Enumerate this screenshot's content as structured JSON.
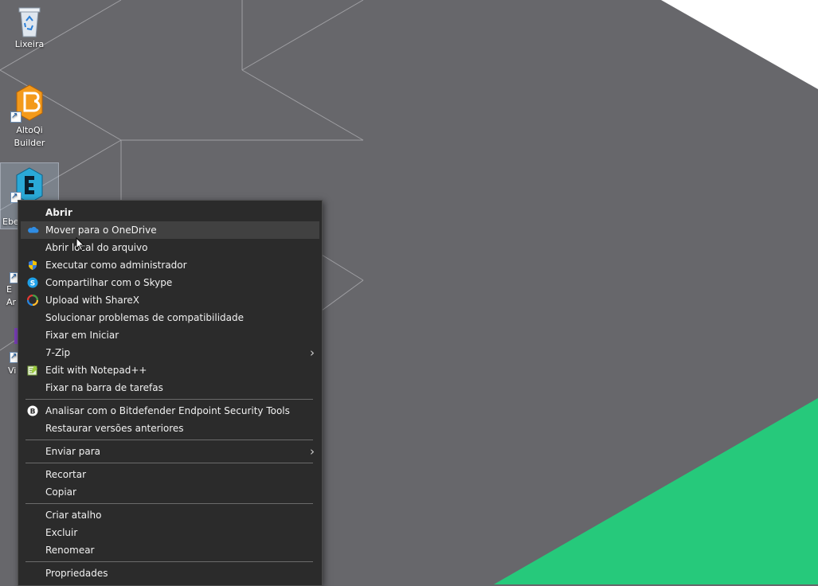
{
  "desktop": {
    "icons": [
      {
        "label": "Lixeira",
        "icon": "recycle-bin-icon"
      },
      {
        "label": "AltoQi\nBuilder",
        "icon": "altoqi-builder-icon"
      },
      {
        "label": "Ebe",
        "icon": "eberick-icon"
      },
      {
        "label": "E\nAr",
        "icon": "shortcut-app-icon"
      },
      {
        "label": "Vi",
        "icon": "shortcut-app-icon"
      }
    ],
    "colors": {
      "wallpaper": "#67676b",
      "accent_green": "#26c97b",
      "accent_white": "#ffffff"
    }
  },
  "context_menu": {
    "items": [
      {
        "label": "Abrir",
        "bold": true
      },
      {
        "label": "Mover para o OneDrive",
        "icon": "onedrive-icon",
        "hover": true
      },
      {
        "label": "Abrir local do arquivo"
      },
      {
        "label": "Executar como administrador",
        "icon": "uac-shield-icon"
      },
      {
        "label": "Compartilhar com o Skype",
        "icon": "skype-icon"
      },
      {
        "label": "Upload with ShareX",
        "icon": "sharex-icon"
      },
      {
        "label": "Solucionar problemas de compatibilidade"
      },
      {
        "label": "Fixar em Iniciar"
      },
      {
        "label": "7-Zip",
        "submenu": true
      },
      {
        "label": "Edit with Notepad++",
        "icon": "notepadpp-icon"
      },
      {
        "label": "Fixar na barra de tarefas"
      },
      {
        "label": "Analisar com o Bitdefender Endpoint Security Tools",
        "icon": "bitdefender-icon"
      },
      {
        "label": "Restaurar versões anteriores"
      },
      {
        "label": "Enviar para",
        "submenu": true
      },
      {
        "label": "Recortar"
      },
      {
        "label": "Copiar"
      },
      {
        "label": "Criar atalho"
      },
      {
        "label": "Excluir"
      },
      {
        "label": "Renomear"
      },
      {
        "label": "Propriedades"
      }
    ]
  }
}
